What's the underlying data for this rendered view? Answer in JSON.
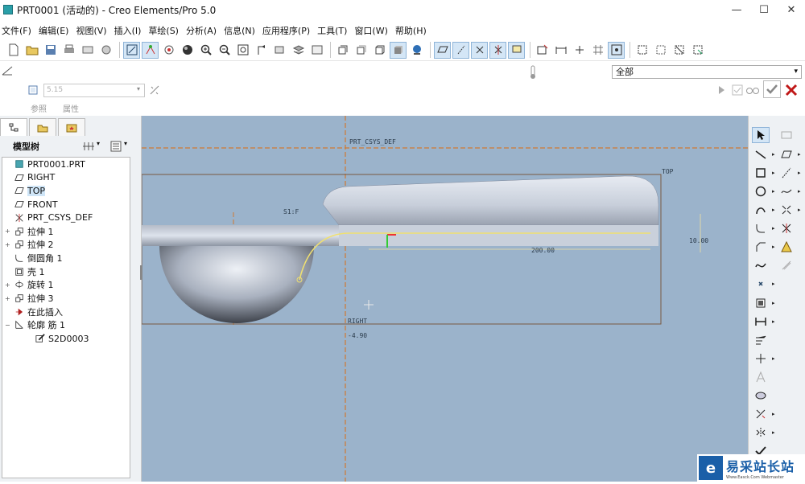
{
  "window": {
    "title": "PRT0001 (活动的) - Creo Elements/Pro 5.0",
    "minimize": "—",
    "maximize": "☐",
    "close": "✕"
  },
  "menu": [
    "文件(F)",
    "编辑(E)",
    "视图(V)",
    "插入(I)",
    "草绘(S)",
    "分析(A)",
    "信息(N)",
    "应用程序(P)",
    "工具(T)",
    "窗口(W)",
    "帮助(H)"
  ],
  "dashboard": {
    "value_placeholder": "5.15",
    "tabs": [
      "参照",
      "属性"
    ],
    "filter_value": "全部"
  },
  "model_tree": {
    "title": "模型树",
    "items": [
      {
        "label": "PRT0001.PRT",
        "icon": "part-icon",
        "expand": ""
      },
      {
        "label": "RIGHT",
        "icon": "datum-plane-icon",
        "expand": ""
      },
      {
        "label": "TOP",
        "icon": "datum-plane-icon",
        "expand": ""
      },
      {
        "label": "FRONT",
        "icon": "datum-plane-icon",
        "expand": ""
      },
      {
        "label": "PRT_CSYS_DEF",
        "icon": "csys-icon",
        "expand": ""
      },
      {
        "label": "拉伸 1",
        "icon": "extrude-icon",
        "expand": "+"
      },
      {
        "label": "拉伸 2",
        "icon": "extrude-icon",
        "expand": "+"
      },
      {
        "label": "倒圆角 1",
        "icon": "round-icon",
        "expand": ""
      },
      {
        "label": "壳 1",
        "icon": "shell-icon",
        "expand": ""
      },
      {
        "label": "旋转 1",
        "icon": "revolve-icon",
        "expand": "+"
      },
      {
        "label": "拉伸 3",
        "icon": "extrude-icon",
        "expand": "+"
      },
      {
        "label": "在此插入",
        "icon": "insert-here-icon",
        "expand": ""
      },
      {
        "label": "轮廓 筋 1",
        "icon": "rib-icon",
        "expand": "−"
      },
      {
        "label": "S2D0003",
        "icon": "sketch-icon",
        "expand": ""
      }
    ]
  },
  "viewport": {
    "labels": {
      "csys": "PRT_CSYS_DEF",
      "top": "TOP",
      "right": "RIGHT",
      "s1": "S1:F",
      "dim_200": "200.00",
      "dim_10": "10.00",
      "dim_neg": "-4.90"
    }
  },
  "watermark": {
    "logo": "e",
    "name": "易采站长站",
    "sub": "Www.Easck.Com Webmaster"
  },
  "colors": {
    "viewport_bg": "#9bb3cb",
    "datum_orange": "#d07a32",
    "sketch_yellow": "#f0e070",
    "part_shade": "#c8d0dc"
  }
}
